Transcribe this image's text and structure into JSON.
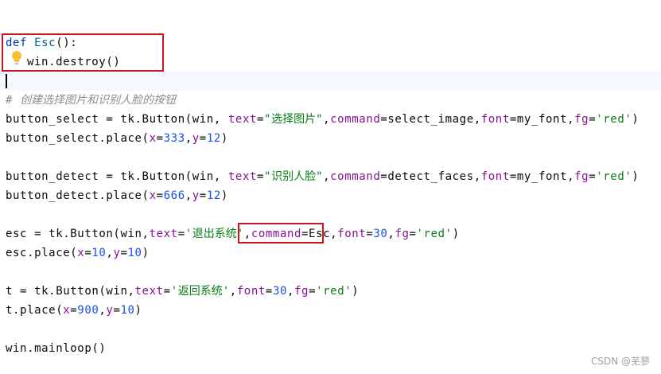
{
  "editor": {
    "caret_line_color": "#f5f8fe",
    "caret_color": "#000000",
    "lines": [
      {
        "tokens": [
          {
            "text": "def",
            "kind": "kw"
          },
          {
            "text": " ",
            "kind": "default"
          },
          {
            "text": "Esc",
            "kind": "fn"
          },
          {
            "text": "():",
            "kind": "default"
          }
        ]
      },
      {
        "tokens": [
          {
            "text": "win.destroy()",
            "kind": "default"
          }
        ],
        "has_bulb": true
      },
      {
        "tokens": [],
        "caret": true
      },
      {
        "tokens": [
          {
            "text": "# ",
            "kind": "comment"
          },
          {
            "text": "创建选择图片和识别人脸的按钮",
            "kind": "comment",
            "cjk": true
          }
        ]
      },
      {
        "tokens": [
          {
            "text": "button_select = tk.Button(win, ",
            "kind": "default"
          },
          {
            "text": "text",
            "kind": "arg"
          },
          {
            "text": "=",
            "kind": "default"
          },
          {
            "text": "\"",
            "kind": "str"
          },
          {
            "text": "选择图片",
            "kind": "str",
            "cjk": true
          },
          {
            "text": "\"",
            "kind": "str"
          },
          {
            "text": ",",
            "kind": "default"
          },
          {
            "text": "command",
            "kind": "arg"
          },
          {
            "text": "=select_image,",
            "kind": "default"
          },
          {
            "text": "font",
            "kind": "arg"
          },
          {
            "text": "=my_font,",
            "kind": "default"
          },
          {
            "text": "fg",
            "kind": "arg"
          },
          {
            "text": "=",
            "kind": "default"
          },
          {
            "text": "'red'",
            "kind": "str"
          },
          {
            "text": ")",
            "kind": "default"
          }
        ]
      },
      {
        "tokens": [
          {
            "text": "button_select.place(",
            "kind": "default"
          },
          {
            "text": "x",
            "kind": "arg"
          },
          {
            "text": "=",
            "kind": "default"
          },
          {
            "text": "333",
            "kind": "num"
          },
          {
            "text": ",",
            "kind": "default"
          },
          {
            "text": "y",
            "kind": "arg"
          },
          {
            "text": "=",
            "kind": "default"
          },
          {
            "text": "12",
            "kind": "num"
          },
          {
            "text": ")",
            "kind": "default"
          }
        ]
      },
      {
        "tokens": []
      },
      {
        "tokens": [
          {
            "text": "button_detect = tk.Button(win, ",
            "kind": "default"
          },
          {
            "text": "text",
            "kind": "arg"
          },
          {
            "text": "=",
            "kind": "default"
          },
          {
            "text": "\"",
            "kind": "str"
          },
          {
            "text": "识别人脸",
            "kind": "str",
            "cjk": true
          },
          {
            "text": "\"",
            "kind": "str"
          },
          {
            "text": ",",
            "kind": "default"
          },
          {
            "text": "command",
            "kind": "arg"
          },
          {
            "text": "=detect_faces,",
            "kind": "default"
          },
          {
            "text": "font",
            "kind": "arg"
          },
          {
            "text": "=my_font,",
            "kind": "default"
          },
          {
            "text": "fg",
            "kind": "arg"
          },
          {
            "text": "=",
            "kind": "default"
          },
          {
            "text": "'red'",
            "kind": "str"
          },
          {
            "text": ")",
            "kind": "default"
          }
        ]
      },
      {
        "tokens": [
          {
            "text": "button_detect.place(",
            "kind": "default"
          },
          {
            "text": "x",
            "kind": "arg"
          },
          {
            "text": "=",
            "kind": "default"
          },
          {
            "text": "666",
            "kind": "num"
          },
          {
            "text": ",",
            "kind": "default"
          },
          {
            "text": "y",
            "kind": "arg"
          },
          {
            "text": "=",
            "kind": "default"
          },
          {
            "text": "12",
            "kind": "num"
          },
          {
            "text": ")",
            "kind": "default"
          }
        ]
      },
      {
        "tokens": []
      },
      {
        "tokens": [
          {
            "text": "esc = tk.Button(win,",
            "kind": "default"
          },
          {
            "text": "text",
            "kind": "arg"
          },
          {
            "text": "=",
            "kind": "default"
          },
          {
            "text": "'",
            "kind": "str"
          },
          {
            "text": "退出系统",
            "kind": "str",
            "cjk": true
          },
          {
            "text": "'",
            "kind": "str"
          },
          {
            "text": ",",
            "kind": "default"
          },
          {
            "text": "command",
            "kind": "arg"
          },
          {
            "text": "=Esc,",
            "kind": "default"
          },
          {
            "text": "font",
            "kind": "arg"
          },
          {
            "text": "=",
            "kind": "default"
          },
          {
            "text": "30",
            "kind": "num"
          },
          {
            "text": ",",
            "kind": "default"
          },
          {
            "text": "fg",
            "kind": "arg"
          },
          {
            "text": "=",
            "kind": "default"
          },
          {
            "text": "'red'",
            "kind": "str"
          },
          {
            "text": ")",
            "kind": "default"
          }
        ]
      },
      {
        "tokens": [
          {
            "text": "esc.place(",
            "kind": "default"
          },
          {
            "text": "x",
            "kind": "arg"
          },
          {
            "text": "=",
            "kind": "default"
          },
          {
            "text": "10",
            "kind": "num"
          },
          {
            "text": ",",
            "kind": "default"
          },
          {
            "text": "y",
            "kind": "arg"
          },
          {
            "text": "=",
            "kind": "default"
          },
          {
            "text": "10",
            "kind": "num"
          },
          {
            "text": ")",
            "kind": "default"
          }
        ]
      },
      {
        "tokens": []
      },
      {
        "tokens": [
          {
            "text": "t = tk.Button(win,",
            "kind": "default"
          },
          {
            "text": "text",
            "kind": "arg"
          },
          {
            "text": "=",
            "kind": "default"
          },
          {
            "text": "'",
            "kind": "str"
          },
          {
            "text": "返回系统",
            "kind": "str",
            "cjk": true
          },
          {
            "text": "'",
            "kind": "str"
          },
          {
            "text": ",",
            "kind": "default"
          },
          {
            "text": "font",
            "kind": "arg"
          },
          {
            "text": "=",
            "kind": "default"
          },
          {
            "text": "30",
            "kind": "num"
          },
          {
            "text": ",",
            "kind": "default"
          },
          {
            "text": "fg",
            "kind": "arg"
          },
          {
            "text": "=",
            "kind": "default"
          },
          {
            "text": "'red'",
            "kind": "str"
          },
          {
            "text": ")",
            "kind": "default"
          }
        ]
      },
      {
        "tokens": [
          {
            "text": "t.place(",
            "kind": "default"
          },
          {
            "text": "x",
            "kind": "arg"
          },
          {
            "text": "=",
            "kind": "default"
          },
          {
            "text": "900",
            "kind": "num"
          },
          {
            "text": ",",
            "kind": "default"
          },
          {
            "text": "y",
            "kind": "arg"
          },
          {
            "text": "=",
            "kind": "default"
          },
          {
            "text": "10",
            "kind": "num"
          },
          {
            "text": ")",
            "kind": "default"
          }
        ]
      },
      {
        "tokens": []
      },
      {
        "tokens": [
          {
            "text": "win.mainloop()",
            "kind": "default"
          }
        ]
      }
    ]
  },
  "highlights": {
    "color": "#d0141b"
  },
  "watermark": {
    "text": "CSDN @芜蓼"
  }
}
